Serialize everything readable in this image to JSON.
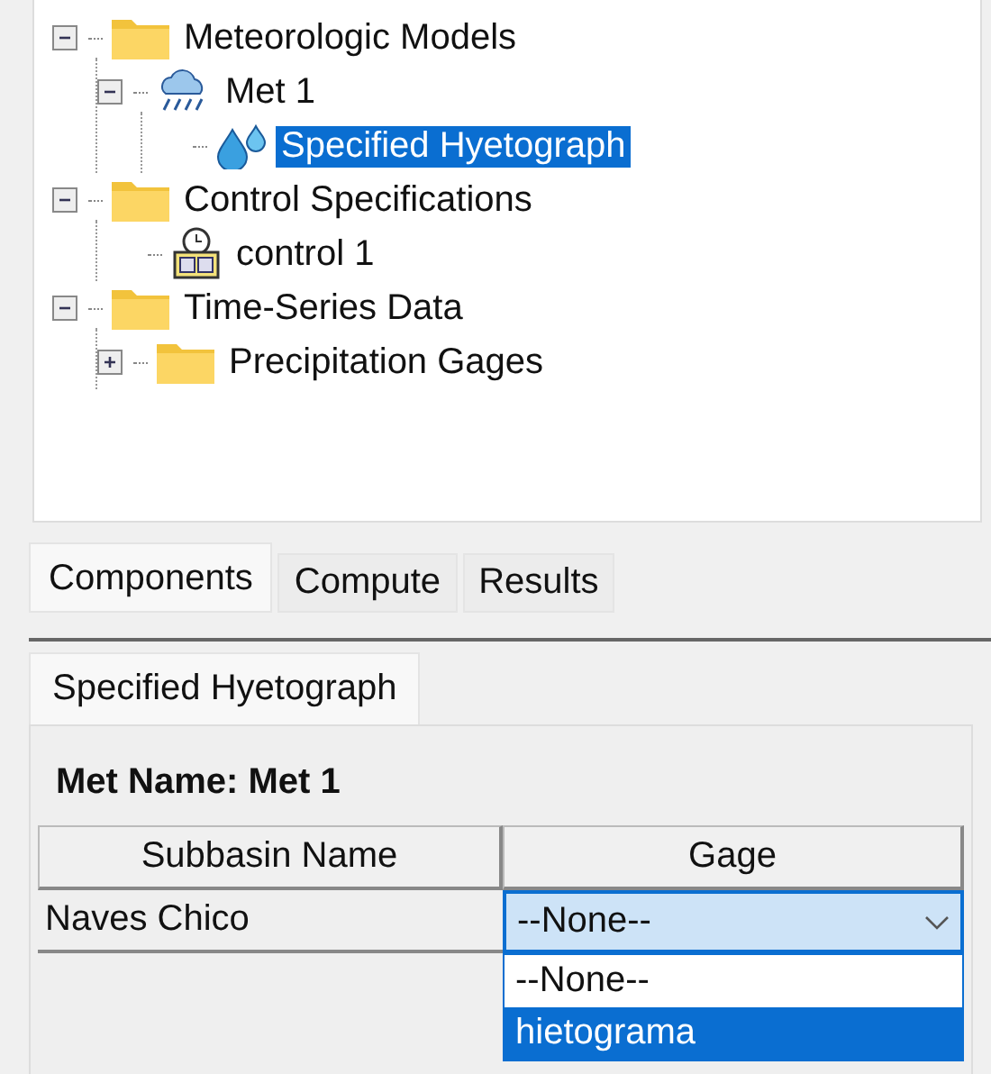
{
  "tree": [
    {
      "label": "Meteorologic Models",
      "kind": "folder",
      "expanded": true,
      "selected": false,
      "children": [
        {
          "label": "Met 1",
          "kind": "meteorology",
          "expanded": true,
          "selected": false,
          "children": [
            {
              "label": "Specified Hyetograph",
              "kind": "precipitation",
              "selected": true
            }
          ]
        }
      ]
    },
    {
      "label": "Control Specifications",
      "kind": "folder",
      "expanded": true,
      "selected": false,
      "children": [
        {
          "label": "control 1",
          "kind": "control",
          "selected": false
        }
      ]
    },
    {
      "label": "Time-Series Data",
      "kind": "folder",
      "expanded": true,
      "selected": false,
      "children": [
        {
          "label": "Precipitation Gages",
          "kind": "folder",
          "expanded": false,
          "selected": false
        }
      ]
    }
  ],
  "bottom_tabs": [
    {
      "label": "Components",
      "selected": true
    },
    {
      "label": "Compute",
      "selected": false
    },
    {
      "label": "Results",
      "selected": false
    }
  ],
  "editor_tabs": [
    {
      "label": "Specified Hyetograph",
      "selected": true
    }
  ],
  "met_name": "Met Name: Met 1",
  "table": {
    "columns": [
      "Subbasin Name",
      "Gage"
    ],
    "rows": [
      {
        "subbasin": "Naves Chico",
        "gage": "--None--"
      }
    ]
  },
  "dropdown_options": [
    {
      "label": "--None--",
      "selected": false
    },
    {
      "label": "hietograma",
      "selected": true
    }
  ]
}
